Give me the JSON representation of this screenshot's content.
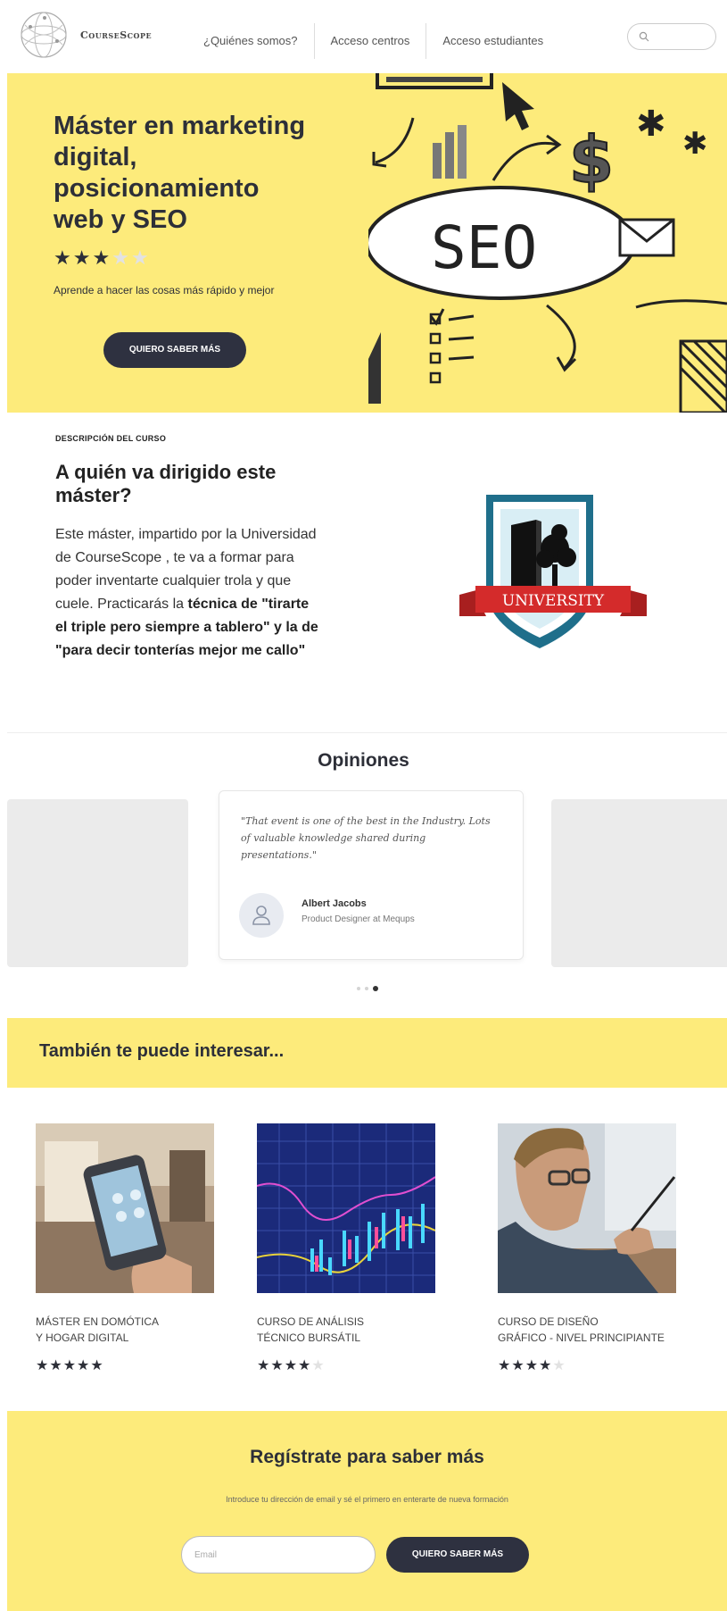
{
  "header": {
    "logo_text": "CourseScope",
    "nav": [
      "¿Quiénes somos?",
      "Acceso centros",
      "Acceso estudiantes"
    ]
  },
  "hero": {
    "title": "Máster en marketing digital, posicionamiento web y SEO",
    "rating": 3,
    "rating_max": 5,
    "subtitle": "Aprende a hacer las cosas más rápido y mejor",
    "cta": "QUIERO SABER MÁS",
    "art_text": "SEO"
  },
  "description": {
    "kicker": "DESCRIPCIÓN DEL CURSO",
    "title": "A quién va dirigido este máster?",
    "body_plain": "Este máster, impartido por la Universidad de CourseScope , te va a formar para poder inventarte cualquier trola y que cuele. Practicarás la ",
    "body_bold": "técnica de \"tirarte el triple pero siempre a tablero\" y la de \"para decir tonterías mejor me callo\"",
    "badge_text": "UNIVERSITY"
  },
  "opinions": {
    "title": "Opiniones",
    "quote": "\"That event is one of the best in the Industry. Lots of valuable knowledge shared during presentations.\"",
    "author": "Albert Jacobs",
    "role": "Product Designer at Mequps",
    "slides": 3,
    "active_slide": 3
  },
  "related": {
    "title": "También te puede interesar...",
    "courses": [
      {
        "line1": "MÁSTER EN DOMÓTICA",
        "line2": "Y HOGAR DIGITAL",
        "rating": 5
      },
      {
        "line1": "CURSO DE ANÁLISIS",
        "line2": "TÉCNICO BURSÁTIL",
        "rating": 4
      },
      {
        "line1": "CURSO DE DISEÑO",
        "line2": "GRÁFICO - NIVEL PRINCIPIANTE",
        "rating": 4
      }
    ]
  },
  "register": {
    "title": "Regístrate para saber más",
    "subtitle": "Introduce tu dirección de email y sé el primero en enterarte de nueva formación",
    "email_placeholder": "Email",
    "cta": "QUIERO SABER MÁS"
  },
  "colors": {
    "accent_yellow": "#fdeb7b",
    "dark_button": "#2e3140",
    "badge_blue": "#1f6f8b",
    "badge_red": "#d42b2b"
  }
}
